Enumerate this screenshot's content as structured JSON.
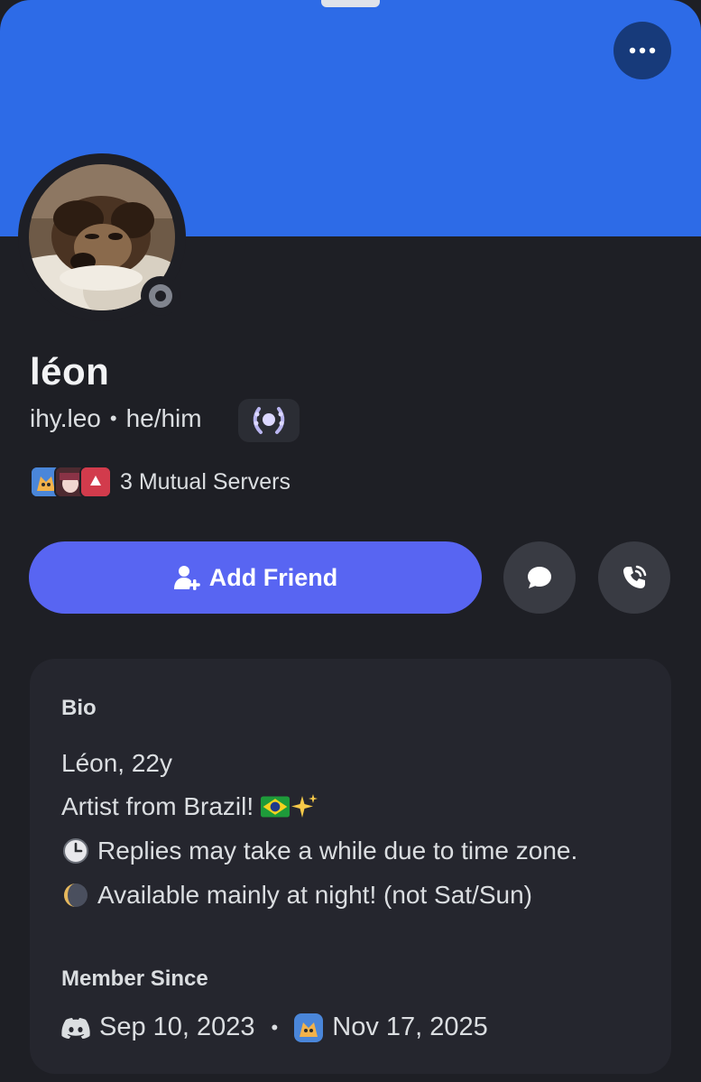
{
  "profile": {
    "display_name": "léon",
    "username": "ihy.leo",
    "separator": "•",
    "pronouns": "he/him",
    "mutual_servers_label": "3 Mutual Servers"
  },
  "actions": {
    "add_friend_label": "Add Friend"
  },
  "bio": {
    "heading": "Bio",
    "lines": [
      "Léon, 22y",
      "Artist from Brazil!",
      "Replies may take a while due to time zone.",
      "Available mainly at night! (not Sat/Sun)"
    ]
  },
  "member_since": {
    "heading": "Member Since",
    "discord_date": "Sep 10, 2023",
    "separator": "•",
    "server_date": "Nov 17, 2025"
  },
  "colors": {
    "banner": "#2d6be7",
    "background": "#1e1f25",
    "card": "#25262e",
    "primary_button": "#5865f2",
    "secondary_button": "#393b43",
    "status_offline": "#80848e"
  },
  "icons": {
    "more": "more-horizontal-icon",
    "status": "offline-status-icon",
    "badge": "wreath-badge-icon",
    "add_friend": "add-user-icon",
    "message": "chat-bubble-icon",
    "call": "phone-call-icon",
    "discord": "discord-logo-icon"
  }
}
